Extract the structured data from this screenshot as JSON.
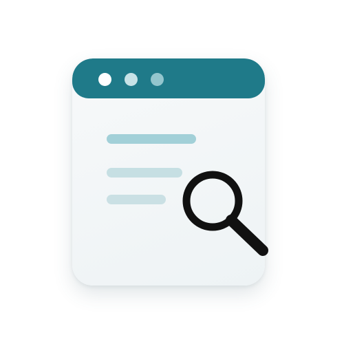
{
  "illustration": {
    "window": {
      "body_color": "#f3f7f8",
      "titlebar_color": "#1f7a89",
      "dots": [
        {
          "color": "#ffffff"
        },
        {
          "color": "#c7e3e7"
        },
        {
          "color": "#93c6ce"
        }
      ],
      "text_line_colors": [
        "#a2d0d8",
        "#c6dfe3",
        "#cae0e4"
      ]
    },
    "icon": "magnifying-glass-icon",
    "icon_color": "#111111"
  }
}
